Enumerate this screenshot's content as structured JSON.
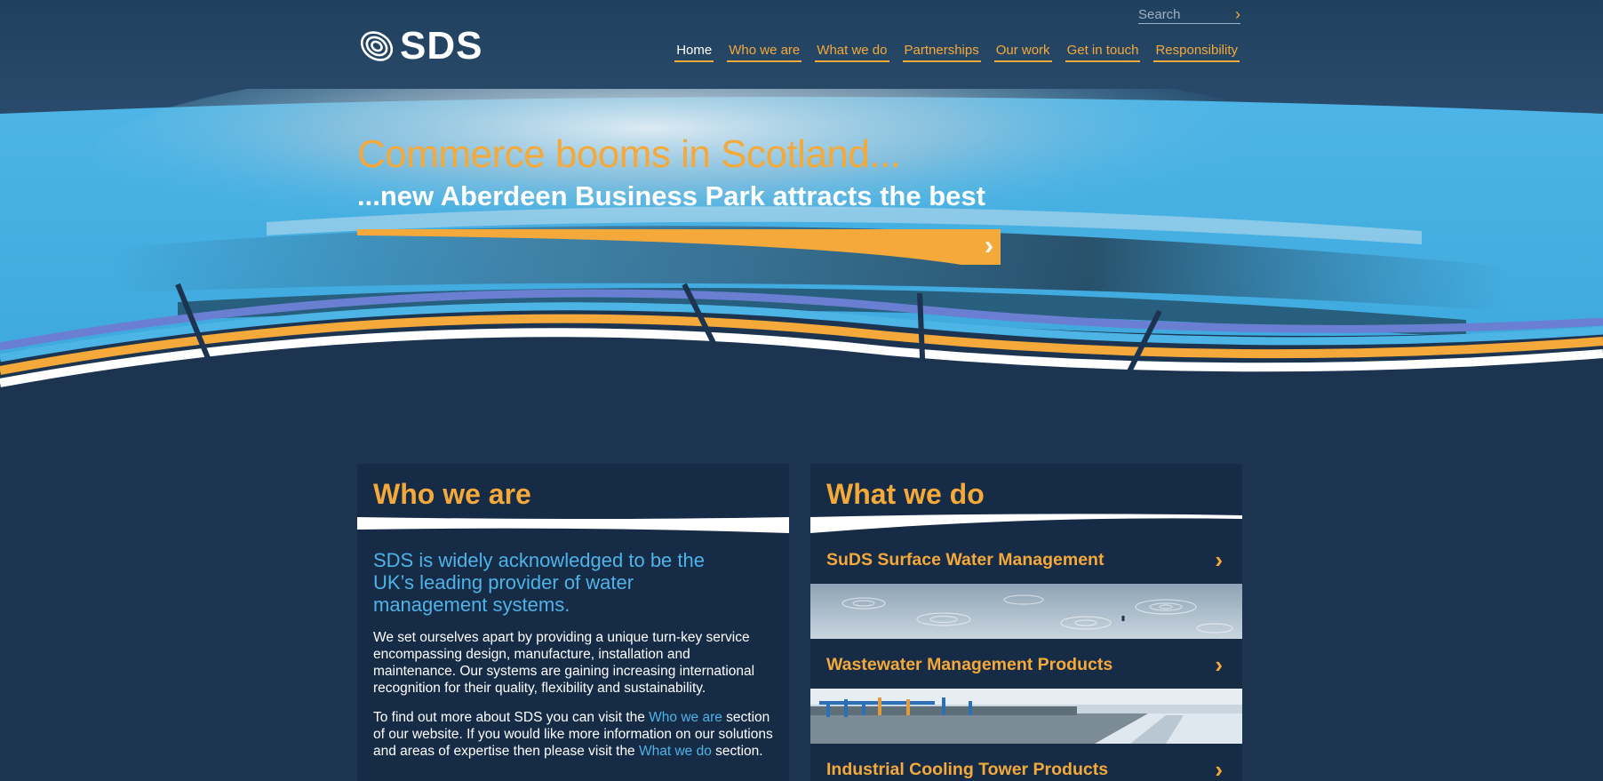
{
  "brand": {
    "name": "SDS",
    "accent": "#f4a93a",
    "link_color": "#4fb3e8",
    "background": "#1c3450"
  },
  "search": {
    "placeholder": "Search",
    "icon": "chevron-right-icon"
  },
  "nav": {
    "items": [
      {
        "label": "Home",
        "active": true
      },
      {
        "label": "Who we are"
      },
      {
        "label": "What we do"
      },
      {
        "label": "Partnerships"
      },
      {
        "label": "Our work"
      },
      {
        "label": "Get in touch"
      },
      {
        "label": "Responsibility"
      }
    ]
  },
  "hero": {
    "title": "Commerce booms in Scotland...",
    "subtitle": "...new Aberdeen Business Park attracts the best",
    "cta_icon": "chevron-right-icon"
  },
  "who_we_are": {
    "heading": "Who we are",
    "lead": "SDS is widely acknowledged to be the UK’s leading provider of water management systems.",
    "paragraph1": "We set ourselves apart by providing a unique turn-key service encompassing design, manufacture, installation and maintenance. Our systems are gaining increasing international recognition for their quality, flexibility and sustainability.",
    "p2_part1": "To find out more about SDS you can visit the ",
    "p2_link1": "Who we are",
    "p2_part2": " section of our website. If you would like more information on our solutions and areas of expertise then please visit the ",
    "p2_link2": "What we do",
    "p2_part3": " section."
  },
  "what_we_do": {
    "heading": "What we do",
    "items": [
      {
        "label": "SuDS Surface Water Management",
        "icon": "chevron-right-icon"
      },
      {
        "label": "Wastewater Management Products",
        "icon": "chevron-right-icon"
      },
      {
        "label": "Industrial Cooling Tower Products",
        "icon": "chevron-right-icon"
      }
    ]
  }
}
